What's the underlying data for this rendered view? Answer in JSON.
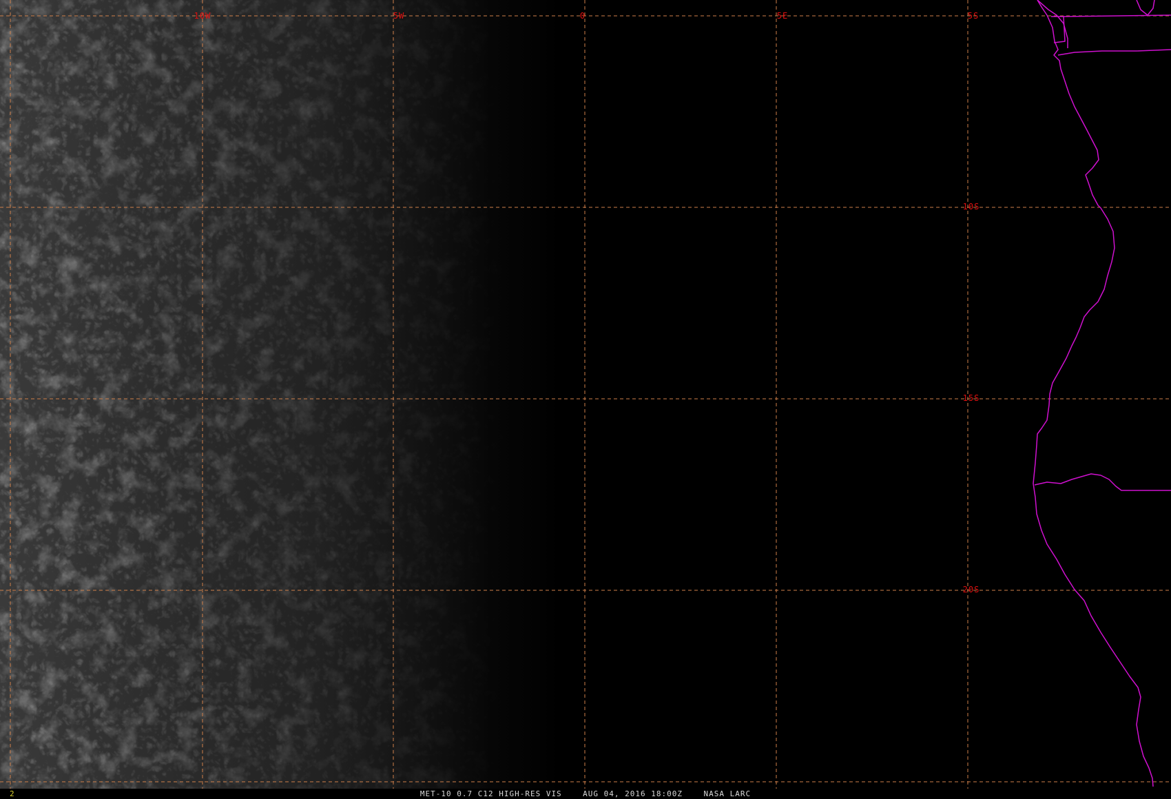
{
  "status_bar": {
    "frame_number": "2",
    "caption": "MET-10 0.7 C12 HIGH-RES VIS    AUG 04, 2016 18:00Z    NASA LARC"
  },
  "grid": {
    "longitude_labels": [
      "10W",
      "5W",
      "0",
      "5E"
    ],
    "latitude_labels": [
      "5S",
      "10S",
      "15S",
      "20S"
    ]
  },
  "colors": {
    "grid_line": "#d0804a",
    "grid_label": "#e01010",
    "coastline": "#d010d0",
    "caption_text": "#d8d8d8",
    "frame_number": "#d8d030"
  }
}
